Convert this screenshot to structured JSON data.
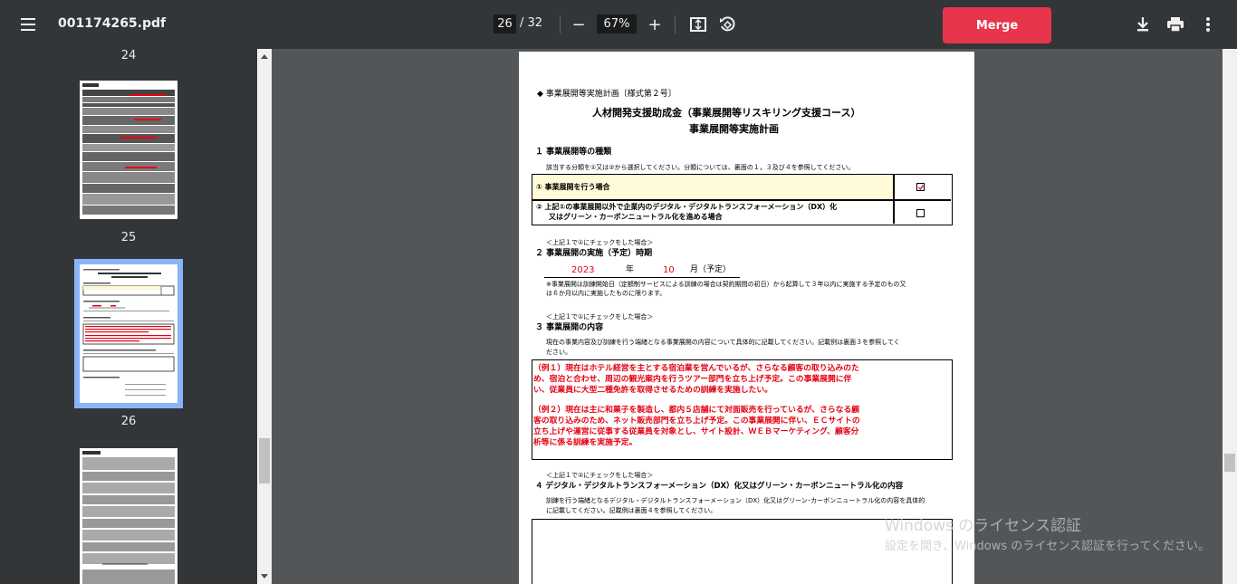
{
  "toolbar": {
    "file_name": "001174265.pdf",
    "current_page": "26",
    "page_total": "/ 32",
    "zoom": "67%",
    "merge_label": "Merge",
    "zoom_out_symbol": "−",
    "zoom_in_symbol": "+"
  },
  "sidebar": {
    "thumbnails": [
      {
        "label": "24"
      },
      {
        "label": "25"
      },
      {
        "label": "26"
      }
    ]
  },
  "document": {
    "form_label": "◆ 事業展開等実施計画〔様式第２号〕",
    "title1": "人材開発支援助成金（事業展開等リスキリング支援コース）",
    "title2": "事業展開等実施計画",
    "s1_heading": "１ 事業展開等の種類",
    "s1_note": "該当する分類を①又は②から選択してください。分類については、裏面の１，３及び４を参照してください。",
    "s1_opt1": "① 事業展開を行う場合",
    "s1_opt2_line1": "② 上記①の事業展開以外で企業内のデジタル・デジタルトランスフォーメーション（DX）化",
    "s1_opt2_line2": "又はグリーン・カーボンニュートラル化を進める場合",
    "s2_pre": "＜上記１で①にチェックをした場合＞",
    "s2_heading": "２ 事業展開の実施（予定）時期",
    "s2_year_value": "2023",
    "s2_year_unit": "年",
    "s2_month_value": "10",
    "s2_month_unit": "月（予定）",
    "s2_note1": "※事業展開は訓練開始日（定額制サービスによる訓練の場合は契約期間の初日）から起算して３年以内に実施する予定のもの又",
    "s2_note2": "は６か月以内に実施したものに限ります。",
    "s3_pre": "＜上記１で①にチェックをした場合＞",
    "s3_heading": "３ 事業展開の内容",
    "s3_note1": "現在の事業内容及び訓練を行う端緒となる事業展開の内容について具体的に記載してください。記載例は裏面３を参照してく",
    "s3_note2": "ださい。",
    "ex1_l1": "（例１）現在はホテル経営を主とする宿泊業を営んでいるが、さらなる顧客の取り込みのた",
    "ex1_l2": "め、宿泊と合わせ、周辺の観光案内を行うツアー部門を立ち上げ予定。この事業展開に伴",
    "ex1_l3": "い、従業員に大型二種免許を取得させるための訓練を実施したい。",
    "ex2_l1": "（例２）現在は主に和菓子を製造し、都内５店舗にて対面販売を行っているが、さらなる顧",
    "ex2_l2": "客の取り込みのため、ネット販売部門を立ち上げ予定。この事業展開に伴い、ＥＣサイトの",
    "ex2_l3": "立ち上げや運営に従事する従業員を対象とし、サイト設計、ＷＥＢマーケティング、顧客分",
    "ex2_l4": "析等に係る訓練を実施予定。",
    "s4_pre": "＜上記１で②にチェックをした場合＞",
    "s4_heading": "４ デジタル・デジタルトランスフォーメーション（DX）化又はグリーン・カーボンニュートラル化の内容",
    "s4_note1": "訓練を行う端緒となるデジタル・デジタルトランスフォーメーション（DX）化又はグリーン･カーボンニュートラル化の内容を具体的",
    "s4_note2": "に記載してください。記載例は裏面４を参照してください。"
  },
  "watermark": {
    "line1": "Windows のライセンス認証",
    "line2": "設定を開き、Windows のライセンス認証を行ってください。"
  },
  "colors": {
    "toolbar_bg": "#323639",
    "merge_bg": "#e8354b",
    "example_text": "#e60012",
    "selected_outline": "#8ab4f8"
  }
}
